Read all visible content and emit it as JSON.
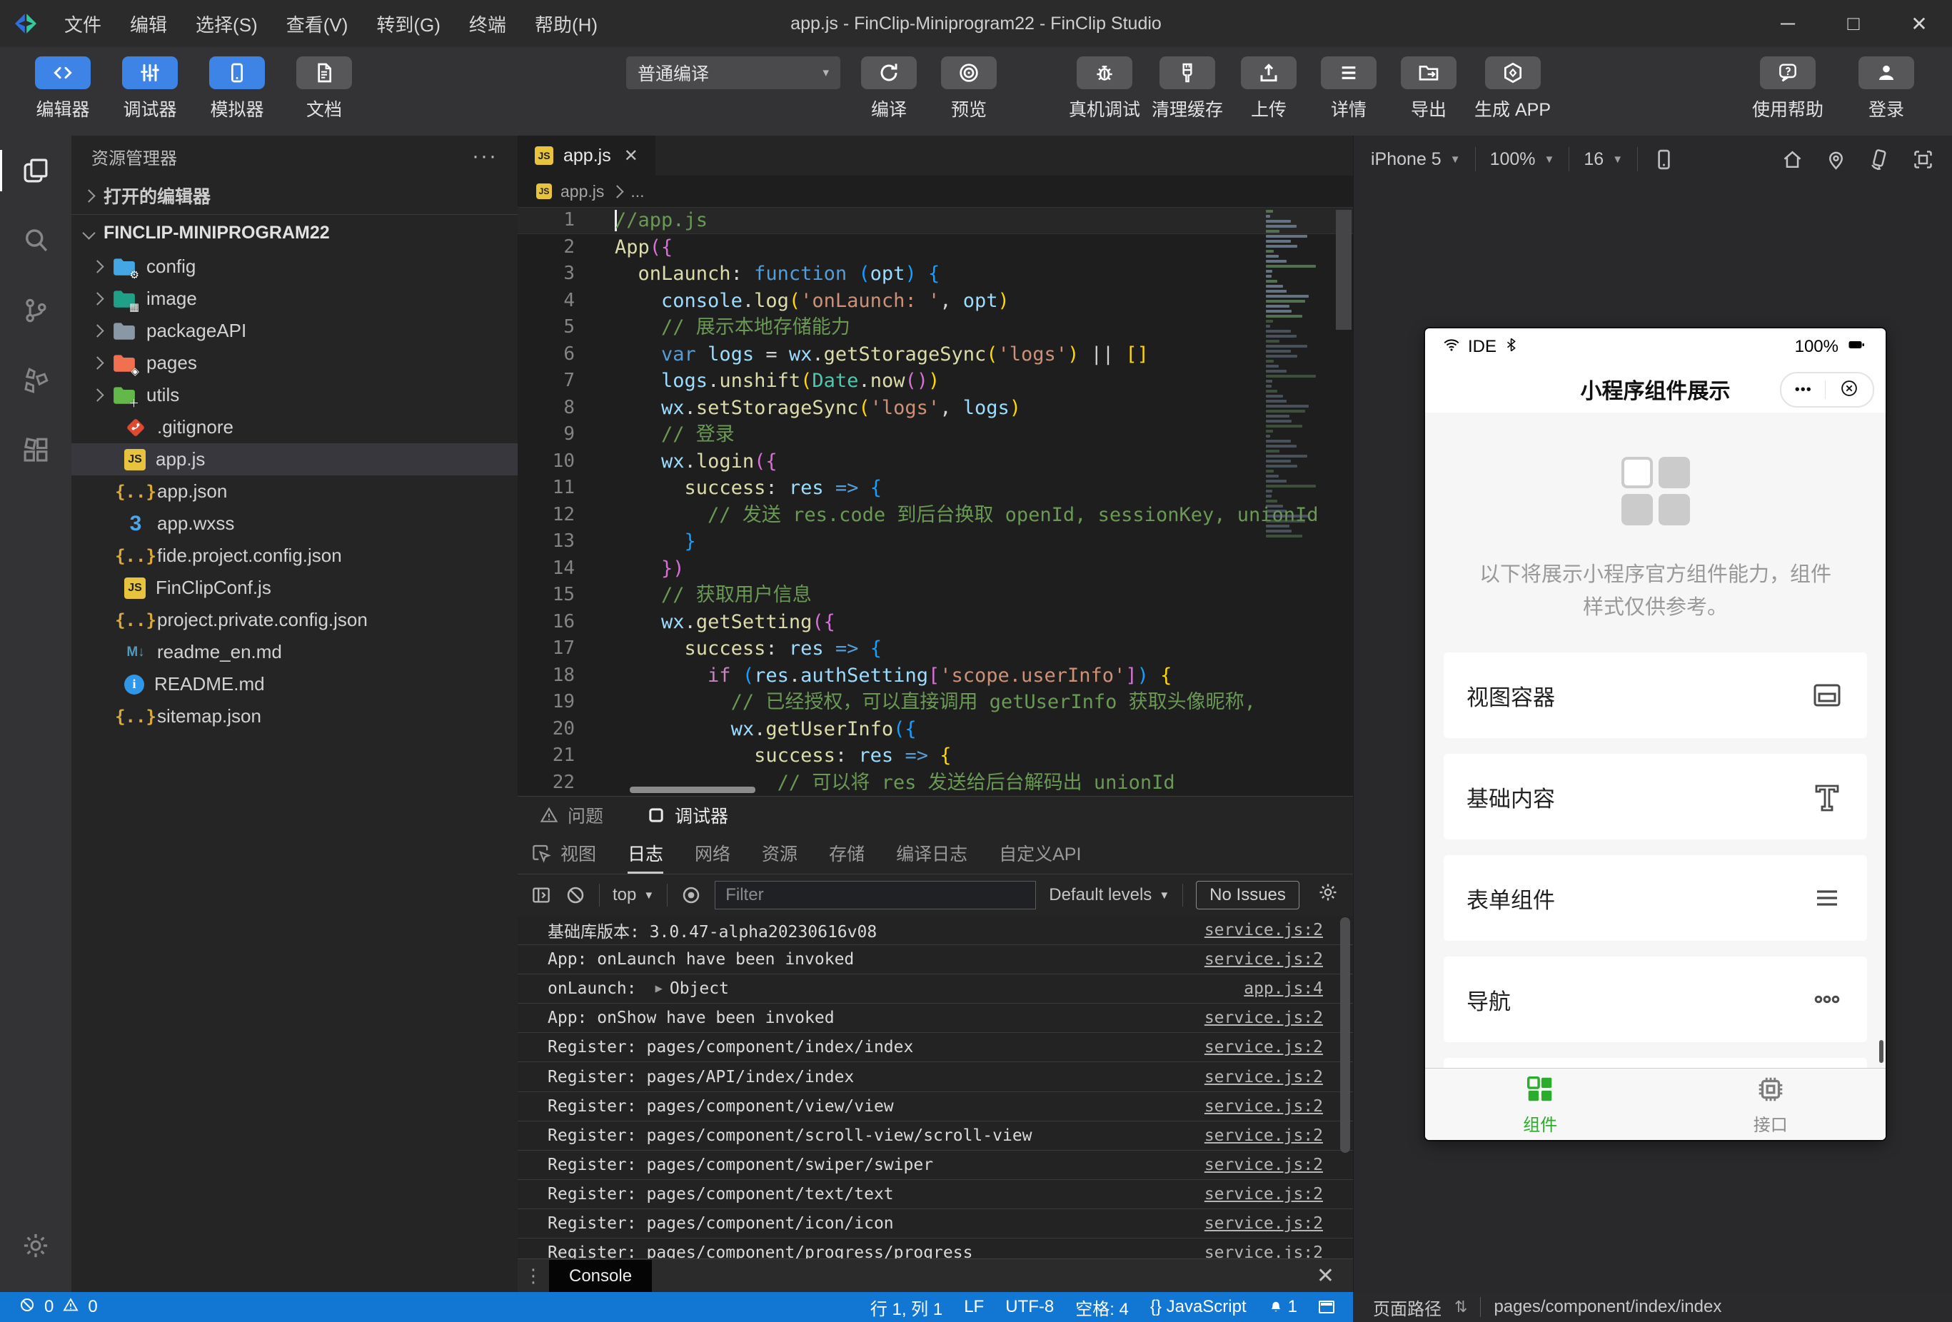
{
  "window": {
    "title": "app.js - FinClip-Miniprogram22 - FinClip Studio",
    "menu": [
      "文件",
      "编辑",
      "选择(S)",
      "查看(V)",
      "转到(G)",
      "终端",
      "帮助(H)"
    ],
    "controls": [
      "─",
      "□",
      "✕"
    ]
  },
  "toolbar": {
    "left_buttons": [
      {
        "label": "编辑器",
        "icon": "code-icon",
        "active": true
      },
      {
        "label": "调试器",
        "icon": "sliders-icon",
        "active": true
      },
      {
        "label": "模拟器",
        "icon": "phone-icon",
        "active": true
      },
      {
        "label": "文档",
        "icon": "doc-icon",
        "active": false
      }
    ],
    "compile_mode": "普通编译",
    "compile_buttons": [
      {
        "label": "编译",
        "icon": "refresh-icon"
      },
      {
        "label": "预览",
        "icon": "target-icon"
      }
    ],
    "action_buttons": [
      {
        "label": "真机调试",
        "icon": "bug-icon"
      },
      {
        "label": "清理缓存",
        "icon": "brush-icon"
      },
      {
        "label": "上传",
        "icon": "upload-icon"
      },
      {
        "label": "详情",
        "icon": "list-icon"
      },
      {
        "label": "导出",
        "icon": "export-icon"
      },
      {
        "label": "生成 APP",
        "icon": "appbox-icon"
      }
    ],
    "right_buttons": [
      {
        "label": "使用帮助",
        "icon": "help-icon"
      },
      {
        "label": "登录",
        "icon": "user-icon"
      }
    ]
  },
  "activity_bar": [
    {
      "icon": "files-icon",
      "active": true
    },
    {
      "icon": "search-icon",
      "active": false
    },
    {
      "icon": "git-icon",
      "active": false
    },
    {
      "icon": "plugin-icon",
      "active": false
    },
    {
      "icon": "extensions-icon",
      "active": false
    }
  ],
  "sidebar": {
    "title": "资源管理器",
    "more": "···",
    "open_editors": "打开的编辑器",
    "root": "FINCLIP-MINIPROGRAM22",
    "items": [
      {
        "name": "config",
        "type": "folder",
        "color": "#45a6e5",
        "badge": "⚙"
      },
      {
        "name": "image",
        "type": "folder",
        "color": "#1fa188",
        "badge": "▦"
      },
      {
        "name": "packageAPI",
        "type": "folder",
        "color": "#8a97a5",
        "badge": ""
      },
      {
        "name": "pages",
        "type": "folder",
        "color": "#f07050",
        "badge": "◈"
      },
      {
        "name": "utils",
        "type": "folder",
        "color": "#63b84a",
        "badge": "＋"
      },
      {
        "name": ".gitignore",
        "type": "git",
        "selected": false
      },
      {
        "name": "app.js",
        "type": "js",
        "selected": true
      },
      {
        "name": "app.json",
        "type": "json",
        "selected": false
      },
      {
        "name": "app.wxss",
        "type": "css",
        "selected": false
      },
      {
        "name": "fide.project.config.json",
        "type": "json",
        "selected": false
      },
      {
        "name": "FinClipConf.js",
        "type": "js",
        "selected": false
      },
      {
        "name": "project.private.config.json",
        "type": "json",
        "selected": false
      },
      {
        "name": "readme_en.md",
        "type": "md",
        "selected": false
      },
      {
        "name": "README.md",
        "type": "info",
        "selected": false
      },
      {
        "name": "sitemap.json",
        "type": "json",
        "selected": false
      }
    ]
  },
  "editor": {
    "tab": "app.js",
    "breadcrumb": [
      "app.js",
      "..."
    ],
    "code": [
      [
        [
          "c",
          "//app.js"
        ]
      ],
      [
        [
          "f",
          "App"
        ],
        [
          "b2",
          "("
        ],
        [
          "b2",
          "{"
        ]
      ],
      [
        [
          "p",
          "  "
        ],
        [
          "f",
          "onLaunch"
        ],
        [
          "p",
          ": "
        ],
        [
          "k",
          "function"
        ],
        [
          "p",
          " "
        ],
        [
          "b3",
          "("
        ],
        [
          "v",
          "opt"
        ],
        [
          "b3",
          ")"
        ],
        [
          "p",
          " "
        ],
        [
          "b3",
          "{"
        ]
      ],
      [
        [
          "p",
          "    "
        ],
        [
          "v",
          "console"
        ],
        [
          "p",
          "."
        ],
        [
          "f",
          "log"
        ],
        [
          "b1",
          "("
        ],
        [
          "s",
          "'onLaunch: '"
        ],
        [
          "p",
          ", "
        ],
        [
          "v",
          "opt"
        ],
        [
          "b1",
          ")"
        ]
      ],
      [
        [
          "p",
          "    "
        ],
        [
          "c",
          "// 展示本地存储能力"
        ]
      ],
      [
        [
          "p",
          "    "
        ],
        [
          "k",
          "var"
        ],
        [
          "p",
          " "
        ],
        [
          "v",
          "logs"
        ],
        [
          "p",
          " = "
        ],
        [
          "v",
          "wx"
        ],
        [
          "p",
          "."
        ],
        [
          "f",
          "getStorageSync"
        ],
        [
          "b1",
          "("
        ],
        [
          "s",
          "'logs'"
        ],
        [
          "b1",
          ")"
        ],
        [
          "p",
          " || "
        ],
        [
          "b1",
          "[]"
        ]
      ],
      [
        [
          "p",
          "    "
        ],
        [
          "v",
          "logs"
        ],
        [
          "p",
          "."
        ],
        [
          "f",
          "unshift"
        ],
        [
          "b1",
          "("
        ],
        [
          "t",
          "Date"
        ],
        [
          "p",
          "."
        ],
        [
          "f",
          "now"
        ],
        [
          "b2",
          "()"
        ],
        [
          "b1",
          ")"
        ]
      ],
      [
        [
          "p",
          "    "
        ],
        [
          "v",
          "wx"
        ],
        [
          "p",
          "."
        ],
        [
          "f",
          "setStorageSync"
        ],
        [
          "b1",
          "("
        ],
        [
          "s",
          "'logs'"
        ],
        [
          "p",
          ", "
        ],
        [
          "v",
          "logs"
        ],
        [
          "b1",
          ")"
        ]
      ],
      [
        [
          "p",
          "    "
        ],
        [
          "c",
          "// 登录"
        ]
      ],
      [
        [
          "p",
          "    "
        ],
        [
          "v",
          "wx"
        ],
        [
          "p",
          "."
        ],
        [
          "f",
          "login"
        ],
        [
          "b2",
          "("
        ],
        [
          "b2",
          "{"
        ]
      ],
      [
        [
          "p",
          "      "
        ],
        [
          "f",
          "success"
        ],
        [
          "p",
          ": "
        ],
        [
          "v",
          "res"
        ],
        [
          "p",
          " "
        ],
        [
          "k",
          "=>"
        ],
        [
          "p",
          " "
        ],
        [
          "b3",
          "{"
        ]
      ],
      [
        [
          "p",
          "        "
        ],
        [
          "c",
          "// 发送 res.code 到后台换取 openId, sessionKey, unionId"
        ]
      ],
      [
        [
          "p",
          "      "
        ],
        [
          "b3",
          "}"
        ]
      ],
      [
        [
          "p",
          "    "
        ],
        [
          "b2",
          "})"
        ]
      ],
      [
        [
          "p",
          "    "
        ],
        [
          "c",
          "// 获取用户信息"
        ]
      ],
      [
        [
          "p",
          "    "
        ],
        [
          "v",
          "wx"
        ],
        [
          "p",
          "."
        ],
        [
          "f",
          "getSetting"
        ],
        [
          "b2",
          "("
        ],
        [
          "b2",
          "{"
        ]
      ],
      [
        [
          "p",
          "      "
        ],
        [
          "f",
          "success"
        ],
        [
          "p",
          ": "
        ],
        [
          "v",
          "res"
        ],
        [
          "p",
          " "
        ],
        [
          "k",
          "=>"
        ],
        [
          "p",
          " "
        ],
        [
          "b3",
          "{"
        ]
      ],
      [
        [
          "p",
          "        "
        ],
        [
          "k2",
          "if"
        ],
        [
          "p",
          " "
        ],
        [
          "b3",
          "("
        ],
        [
          "v",
          "res"
        ],
        [
          "p",
          "."
        ],
        [
          "v",
          "authSetting"
        ],
        [
          "b2",
          "["
        ],
        [
          "s",
          "'scope.userInfo'"
        ],
        [
          "b2",
          "]"
        ],
        [
          "b3",
          ")"
        ],
        [
          "p",
          " "
        ],
        [
          "b1",
          "{"
        ]
      ],
      [
        [
          "p",
          "          "
        ],
        [
          "c",
          "// 已经授权，可以直接调用 getUserInfo 获取头像昵称,"
        ]
      ],
      [
        [
          "p",
          "          "
        ],
        [
          "v",
          "wx"
        ],
        [
          "p",
          "."
        ],
        [
          "f",
          "getUserInfo"
        ],
        [
          "b3",
          "("
        ],
        [
          "b3",
          "{"
        ]
      ],
      [
        [
          "p",
          "            "
        ],
        [
          "f",
          "success"
        ],
        [
          "p",
          ": "
        ],
        [
          "v",
          "res"
        ],
        [
          "p",
          " "
        ],
        [
          "k",
          "=>"
        ],
        [
          "p",
          " "
        ],
        [
          "b1",
          "{"
        ]
      ],
      [
        [
          "p",
          "              "
        ],
        [
          "c",
          "// 可以将 res 发送给后台解码出 unionId"
        ]
      ]
    ]
  },
  "debug": {
    "panel_tabs": [
      {
        "label": "问题",
        "icon": "warn-icon",
        "active": false
      },
      {
        "label": "调试器",
        "icon": "panel-icon",
        "active": true
      }
    ],
    "tool_tabs": [
      {
        "label": "视图",
        "active": false,
        "icon": "inspect-icon"
      },
      {
        "label": "日志",
        "active": true,
        "icon": ""
      },
      {
        "label": "网络",
        "active": false,
        "icon": ""
      },
      {
        "label": "资源",
        "active": false,
        "icon": ""
      },
      {
        "label": "存储",
        "active": false,
        "icon": ""
      },
      {
        "label": "编译日志",
        "active": false,
        "icon": ""
      },
      {
        "label": "自定义API",
        "active": false,
        "icon": ""
      }
    ],
    "toolbar": {
      "context": "top",
      "filter_placeholder": "Filter",
      "levels": "Default levels",
      "issues": "No Issues"
    },
    "logs": [
      {
        "text": "基础库版本: 3.0.47-alpha20230616v08",
        "source": "service.js:2"
      },
      {
        "text": "App: onLaunch have been invoked",
        "source": "service.js:2"
      },
      {
        "text": "onLaunch:",
        "object": "Object",
        "source": "app.js:4"
      },
      {
        "text": "App: onShow have been invoked",
        "source": "service.js:2"
      },
      {
        "text": "Register: pages/component/index/index",
        "source": "service.js:2"
      },
      {
        "text": "Register: pages/API/index/index",
        "source": "service.js:2"
      },
      {
        "text": "Register: pages/component/view/view",
        "source": "service.js:2"
      },
      {
        "text": "Register: pages/component/scroll-view/scroll-view",
        "source": "service.js:2"
      },
      {
        "text": "Register: pages/component/swiper/swiper",
        "source": "service.js:2"
      },
      {
        "text": "Register: pages/component/text/text",
        "source": "service.js:2"
      },
      {
        "text": "Register: pages/component/icon/icon",
        "source": "service.js:2"
      },
      {
        "text": "Register: pages/component/progress/progress",
        "source": "service.js:2"
      }
    ],
    "footer_tab": "Console"
  },
  "simulator": {
    "device": "iPhone 5",
    "zoom": "100%",
    "font_size": "16",
    "phone": {
      "carrier": "IDE",
      "battery": "100%",
      "title": "小程序组件展示",
      "description": [
        "以下将展示小程序官方组件能力，组件",
        "样式仅供参考。"
      ],
      "cards": [
        {
          "label": "视图容器",
          "icon": "card-window-icon"
        },
        {
          "label": "基础内容",
          "icon": "card-text-icon"
        },
        {
          "label": "表单组件",
          "icon": "card-lines-icon"
        },
        {
          "label": "导航",
          "icon": "card-dots-icon"
        },
        {
          "label": "",
          "icon": ""
        }
      ],
      "tabs": [
        {
          "label": "组件",
          "icon": "grid-icon",
          "active": true
        },
        {
          "label": "接口",
          "icon": "chip-icon",
          "active": false
        }
      ],
      "accent": "#2aad2a"
    }
  },
  "status_bar": {
    "errors": "0",
    "warnings": "0",
    "items": [
      "行 1, 列 1",
      "LF",
      "UTF-8",
      "空格: 4",
      "{} JavaScript"
    ],
    "notifications": "1",
    "page_path_label": "页面路径",
    "page_path": "pages/component/index/index"
  }
}
